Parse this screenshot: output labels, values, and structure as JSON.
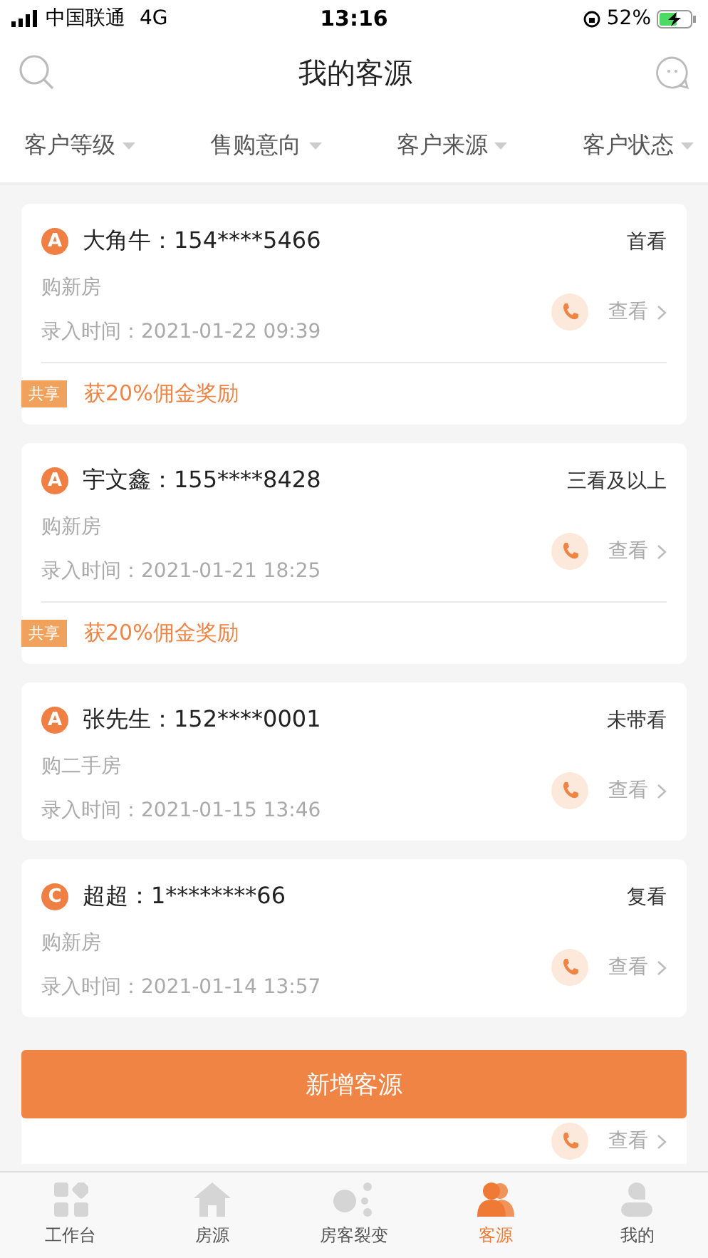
{
  "status_bar": {
    "carrier": "中国联通",
    "network": "4G",
    "time": "13:16",
    "battery": "52%"
  },
  "nav": {
    "title": "我的客源"
  },
  "filters": [
    {
      "label": "客户等级"
    },
    {
      "label": "售购意向"
    },
    {
      "label": "客户来源"
    },
    {
      "label": "客户状态"
    }
  ],
  "customers": [
    {
      "grade": "A",
      "name_phone": "大角牛：154****5466",
      "stage": "首看",
      "intent": "购新房",
      "entered": "录入时间：2021-01-22 09:39",
      "action": "查看",
      "share": {
        "tag": "共享",
        "text": "获20%佣金奖励"
      }
    },
    {
      "grade": "A",
      "name_phone": "宇文鑫：155****8428",
      "stage": "三看及以上",
      "intent": "购新房",
      "entered": "录入时间：2021-01-21 18:25",
      "action": "查看",
      "share": {
        "tag": "共享",
        "text": "获20%佣金奖励"
      }
    },
    {
      "grade": "A",
      "name_phone": "张先生：152****0001",
      "stage": "未带看",
      "intent": "购二手房",
      "entered": "录入时间：2021-01-15 13:46",
      "action": "查看"
    },
    {
      "grade": "C",
      "name_phone": "超超：1********66",
      "stage": "复看",
      "intent": "购新房",
      "entered": "录入时间：2021-01-14 13:57",
      "action": "查看"
    }
  ],
  "add_button": "新增客源",
  "partial_card": {
    "action": "查看"
  },
  "tab_bar": [
    {
      "kind": "workbench",
      "label": "工作台",
      "selected": false
    },
    {
      "kind": "house",
      "label": "房源",
      "selected": false
    },
    {
      "kind": "fission",
      "label": "房客裂变",
      "selected": false
    },
    {
      "kind": "clients",
      "label": "客源",
      "selected": true
    },
    {
      "kind": "me",
      "label": "我的",
      "selected": false
    }
  ]
}
